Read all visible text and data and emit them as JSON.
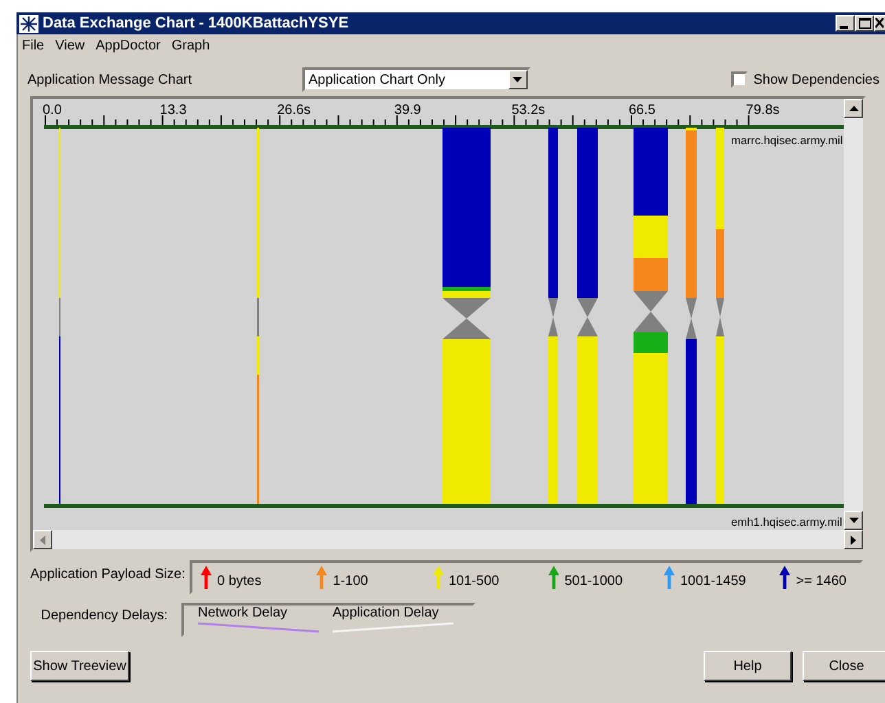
{
  "window": {
    "title": "Data Exchange Chart - 1400KBattachYSYE"
  },
  "menu": [
    {
      "label": "File"
    },
    {
      "label": "View"
    },
    {
      "label": "AppDoctor"
    },
    {
      "label": "Graph"
    }
  ],
  "chart_label": "Application Message Chart",
  "view_select": {
    "value": "Application Chart Only"
  },
  "show_dependencies": {
    "label": "Show Dependencies",
    "checked": false
  },
  "chart": {
    "axis_labels": [
      "0.0",
      "13.3",
      "26.6s",
      "39.9",
      "53.2s",
      "66.5",
      "79.8s"
    ],
    "hosts": [
      "marrc.hqisec.army.mil",
      "emh1.hqisec.army.mil"
    ]
  },
  "payload_legend": {
    "label": "Application Payload Size:",
    "items": [
      {
        "label": "0 bytes",
        "color": "#ff0000"
      },
      {
        "label": "1-100",
        "color": "#f5871c"
      },
      {
        "label": "101-500",
        "color": "#f0ea00"
      },
      {
        "label": "501-1000",
        "color": "#18a818"
      },
      {
        "label": "1001-1459",
        "color": "#2a9af5"
      },
      {
        "label": ">= 1460",
        "color": "#0000b0"
      }
    ]
  },
  "delay_legend": {
    "label": "Dependency Delays:",
    "items": [
      {
        "label": "Network Delay",
        "color": "#b080e8"
      },
      {
        "label": "Application Delay",
        "color": "#f4f4f4"
      }
    ]
  },
  "buttons": [
    {
      "label": "Show Treeview"
    },
    {
      "label": "Help"
    },
    {
      "label": "Close"
    }
  ]
}
